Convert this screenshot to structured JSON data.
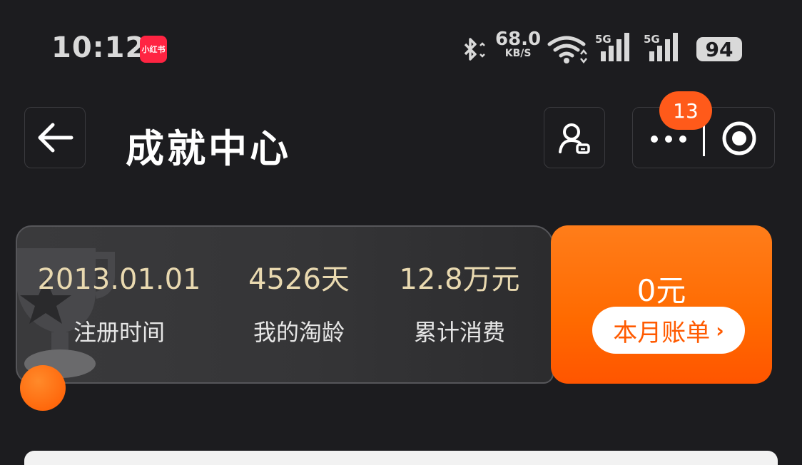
{
  "status_bar": {
    "time": "10:12",
    "app_badge": "小红书",
    "net_speed_value": "68.0",
    "net_speed_unit": "KB/S",
    "signal1_label": "5G",
    "signal2_label": "5G",
    "battery": "94"
  },
  "header": {
    "title": "成就中心",
    "notification_count": "13"
  },
  "stats": [
    {
      "value": "2013.01.01",
      "label": "注册时间"
    },
    {
      "value": "4526天",
      "label": "我的淘龄"
    },
    {
      "value": "12.8万元",
      "label": "累计消费"
    }
  ],
  "bill": {
    "amount": "0元",
    "button_label": "本月账单",
    "button_chevron": "›"
  },
  "colors": {
    "background": "#1c1c1f",
    "accent": "#ff6a00",
    "stat_value": "#e9d9b0"
  }
}
